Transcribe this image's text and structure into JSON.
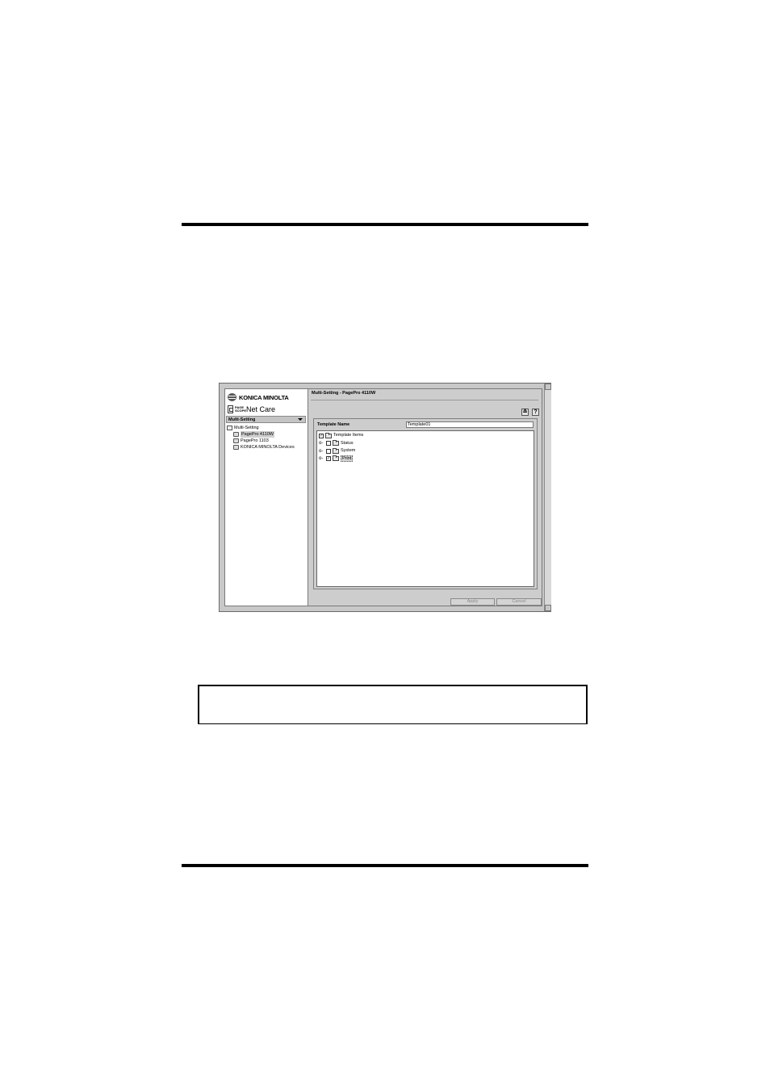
{
  "left_panel": {
    "brand_text": "KONICA MINOLTA",
    "pagescope_mark": "PAGE SCOPE",
    "app_name": "Net Care",
    "view_dropdown_label": "Multi-Setting",
    "tree": [
      {
        "label": "Multi-Setting"
      },
      {
        "label": "PagePro 4110W"
      },
      {
        "label": "PagePro 1103"
      },
      {
        "label": "KONICA MINOLTA Devices"
      }
    ]
  },
  "right_panel": {
    "title": "Multi-Setting - PagePro 4110W",
    "template_name_label": "Template Name",
    "template_name_value": "Template01",
    "tree": [
      {
        "label": "Template Items",
        "checked": true,
        "expander": ""
      },
      {
        "label": "Status",
        "checked": false,
        "expander": "o-"
      },
      {
        "label": "System",
        "checked": false,
        "expander": "o-"
      },
      {
        "label": "Print",
        "checked": true,
        "expander": "o-"
      }
    ],
    "buttons": {
      "apply": "Apply",
      "cancel": "Cancel"
    }
  }
}
